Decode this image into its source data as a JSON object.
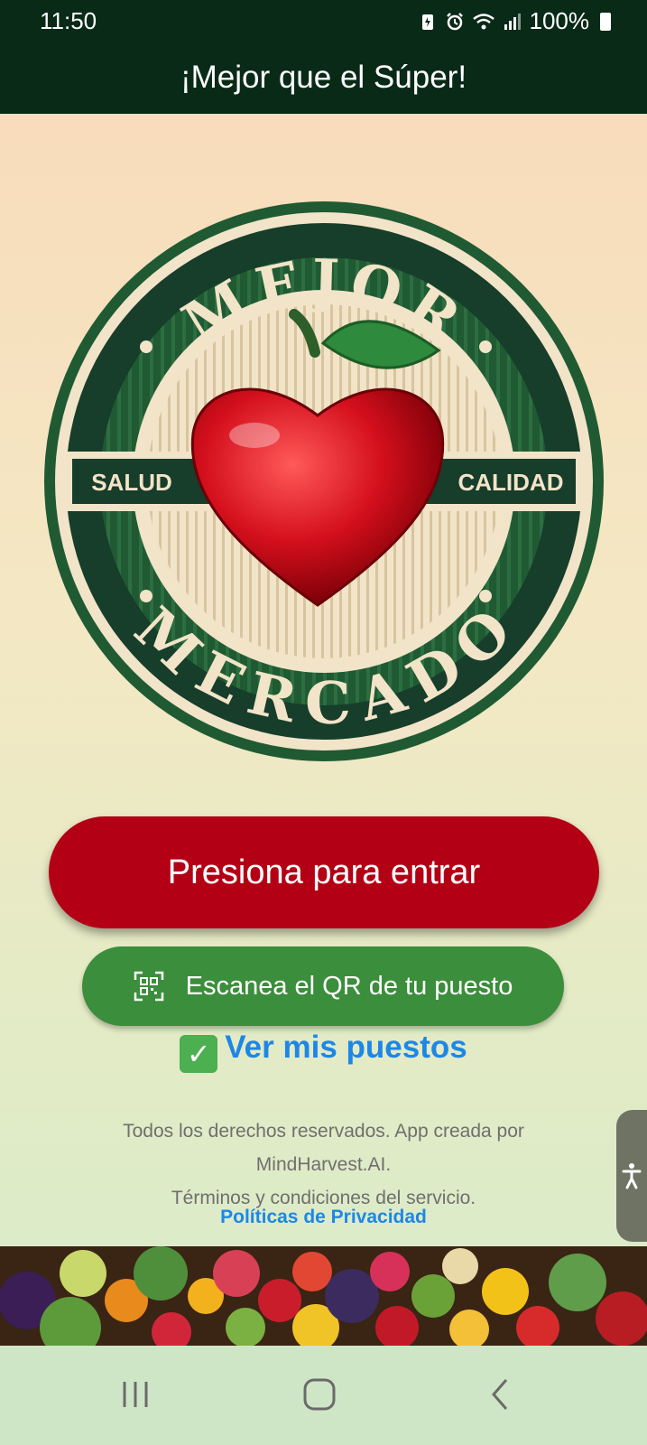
{
  "status_bar": {
    "time": "11:50",
    "battery": "100%",
    "icons": [
      "battery-saver-icon",
      "alarm-icon",
      "wifi-icon",
      "signal-icon",
      "battery-icon"
    ]
  },
  "app_bar": {
    "title": "¡Mejor que el Súper!"
  },
  "logo": {
    "top_text": "MEJOR",
    "bottom_text": "MERCADO",
    "left_label": "SALUD",
    "right_label": "CALIDAD",
    "icon": "heart-apple-icon"
  },
  "buttons": {
    "enter": "Presiona para entrar",
    "scan": "Escanea el QR de tu puesto",
    "stalls": "Ver mis puestos"
  },
  "footer": {
    "line1": "Todos los derechos reservados. App creada por",
    "line2": "MindHarvest.AI.",
    "line3": "Términos y condiciones del servicio.",
    "privacy": "Políticas de Privacidad"
  },
  "colors": {
    "header_bg": "#0a2a18",
    "enter_button": "#b30015",
    "scan_button": "#3b8e3b",
    "link": "#1e87e6",
    "logo_green": "#1f5a33",
    "logo_cream": "#f2e4c8"
  }
}
